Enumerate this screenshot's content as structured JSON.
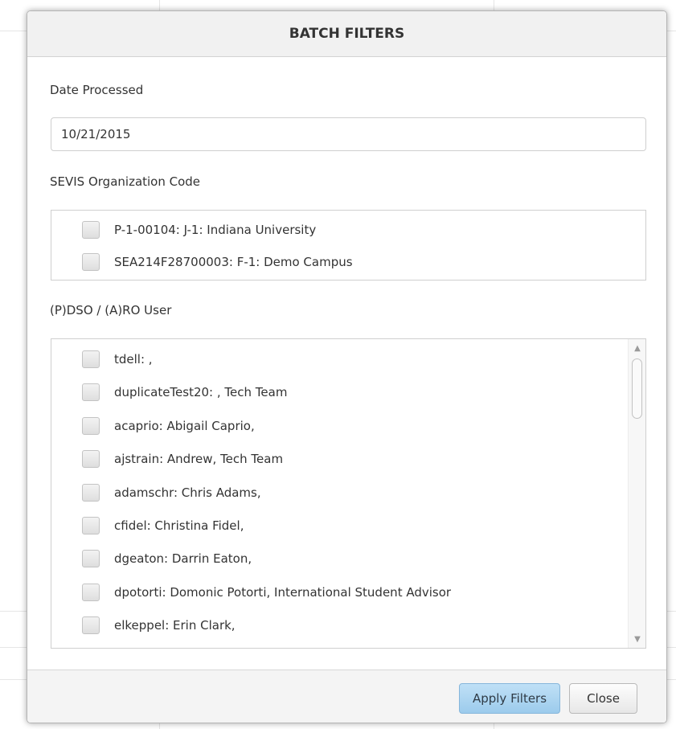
{
  "dialog": {
    "title": "BATCH FILTERS",
    "date_label": "Date Processed",
    "date_value": "10/21/2015",
    "org_label": "SEVIS Organization Code",
    "org_items": [
      "P-1-00104: J-1: Indiana University",
      "SEA214F28700003: F-1: Demo Campus"
    ],
    "user_label": "(P)DSO / (A)RO User",
    "user_items": [
      "tdell: ,",
      "duplicateTest20: , Tech Team",
      "acaprio: Abigail Caprio,",
      "ajstrain: Andrew, Tech Team",
      "adamschr: Chris Adams,",
      "cfidel: Christina Fidel,",
      "dgeaton: Darrin Eaton,",
      "dpotorti: Domonic Potorti, International Student Advisor",
      "elkeppel: Erin Clark,"
    ],
    "apply_label": "Apply Filters",
    "close_label": "Close"
  },
  "colors": {
    "apply_button": "#9ccbec",
    "header_bg": "#f1f1f1"
  }
}
